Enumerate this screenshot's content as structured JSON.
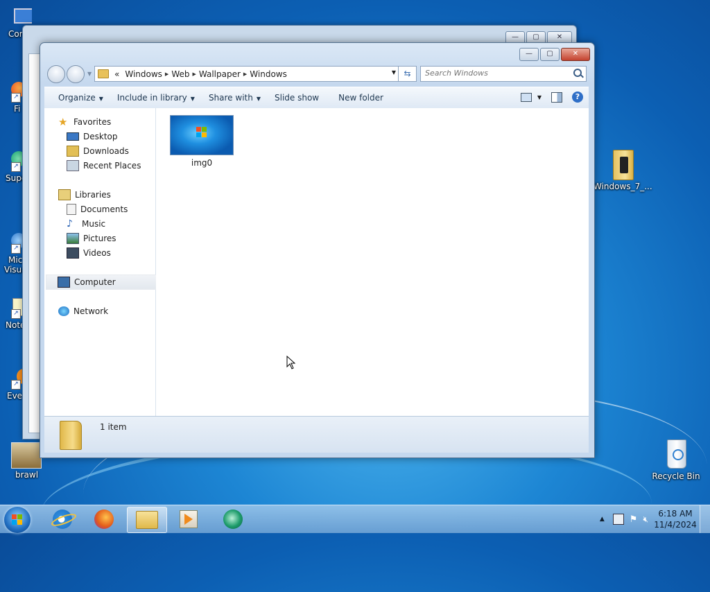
{
  "desktop": {
    "icons_left": [
      {
        "label": "Cor",
        "icon": "computer-icon"
      },
      {
        "label": "Fi",
        "icon": "firefox-icon"
      },
      {
        "label": "Supe",
        "icon": "super-app-icon"
      },
      {
        "label": "Mic",
        "label2": "Visua",
        "icon": "visual-studio-icon"
      },
      {
        "label": "Note",
        "icon": "notepad-icon"
      },
      {
        "label": "Eve",
        "icon": "everything-icon"
      },
      {
        "label": "brawl",
        "icon": "brawl-game-icon"
      }
    ],
    "icons_right": [
      {
        "label": "Windows_7_...",
        "icon": "archive-folder-icon"
      },
      {
        "label": "Recycle Bin",
        "icon": "recycle-bin-icon"
      }
    ]
  },
  "explorer": {
    "breadcrumb": {
      "overflow": "«",
      "segments": [
        "Windows",
        "Web",
        "Wallpaper",
        "Windows"
      ]
    },
    "search": {
      "placeholder": "Search Windows"
    },
    "toolbar": {
      "organize": "Organize",
      "include_in_library": "Include in library",
      "share_with": "Share with",
      "slide_show": "Slide show",
      "new_folder": "New folder"
    },
    "nav": {
      "favorites": {
        "label": "Favorites",
        "items": [
          "Desktop",
          "Downloads",
          "Recent Places"
        ]
      },
      "libraries": {
        "label": "Libraries",
        "items": [
          "Documents",
          "Music",
          "Pictures",
          "Videos"
        ]
      },
      "computer": "Computer",
      "network": "Network"
    },
    "files": [
      {
        "name": "img0",
        "type": "image-thumbnail"
      }
    ],
    "status": {
      "item_count": "1 item"
    }
  },
  "taskbar": {
    "apps": [
      {
        "name": "internet-explorer"
      },
      {
        "name": "firefox"
      },
      {
        "name": "windows-explorer",
        "active": true
      },
      {
        "name": "media-player"
      },
      {
        "name": "greenshot"
      }
    ],
    "clock": {
      "time": "6:18 AM",
      "date": "11/4/2024"
    }
  },
  "colors": {
    "accent": "#2f6fc7",
    "close_red": "#c4422e",
    "folder_yellow": "#e8c15a"
  }
}
